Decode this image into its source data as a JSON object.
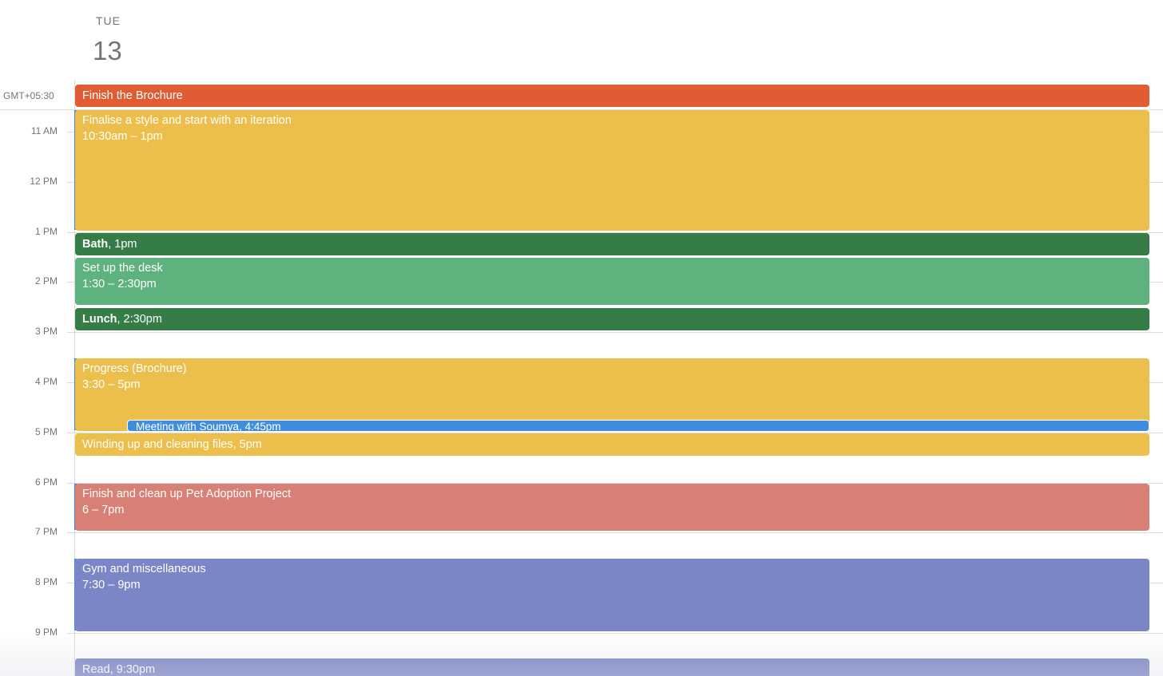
{
  "day": {
    "name": "TUE",
    "number": "13"
  },
  "timezone": "GMT+05:30",
  "hours": [
    "11 AM",
    "12 PM",
    "1 PM",
    "2 PM",
    "3 PM",
    "4 PM",
    "5 PM",
    "6 PM",
    "7 PM",
    "8 PM",
    "9 PM"
  ],
  "all_day_event": {
    "title": "Finish the Brochure",
    "color": "#e25c33"
  },
  "events": [
    {
      "title": "Finalise a style and start with an iteration",
      "time": "10:30am – 1pm",
      "color": "#ecbe4b"
    },
    {
      "title": "Bath",
      "time": ", 1pm",
      "color": "#367c47"
    },
    {
      "title": "Set up the desk",
      "time": "1:30 – 2:30pm",
      "color": "#5db27d"
    },
    {
      "title": "Lunch",
      "time": ", 2:30pm",
      "color": "#367c47"
    },
    {
      "title": "Progress (Brochure)",
      "time": "3:30 – 5pm",
      "color": "#ecbe4b"
    },
    {
      "title": "Meeting with Soumya",
      "time": ", 4:45pm",
      "color": "#3f8ede"
    },
    {
      "title": "Winding up and cleaning files",
      "time": ", 5pm",
      "color": "#ecbe4b"
    },
    {
      "title": "Finish and clean up Pet Adoption Project",
      "time": "6 – 7pm",
      "color": "#d98076"
    },
    {
      "title": "Gym and miscellaneous",
      "time": "7:30 – 9pm",
      "color": "#7b86c6"
    },
    {
      "title": "Read",
      "time": ", 9:30pm",
      "color": "#7b86c6"
    }
  ]
}
